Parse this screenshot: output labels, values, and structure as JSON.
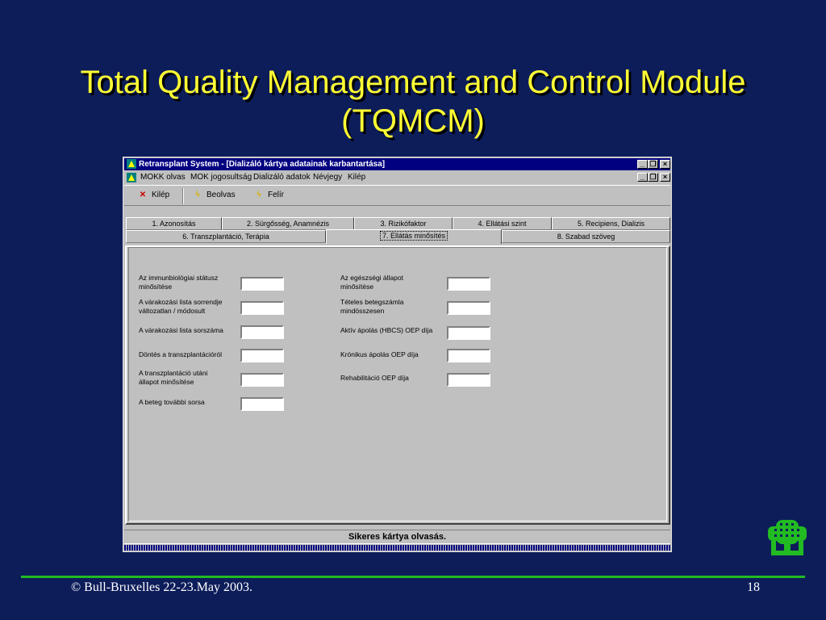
{
  "slide": {
    "title_line1": "Total Quality Management and Control Module",
    "title_line2": "(TQMCM)",
    "footer_left": "© Bull-Bruxelles 22-23.May 2003.",
    "footer_page": "18"
  },
  "window": {
    "title": "Retransplant System - [Dializáló kártya adatainak karbantartása]",
    "controls": {
      "minimize": "_",
      "restore": "❐",
      "close": "×"
    }
  },
  "menu": {
    "items": [
      "MOKK olvas",
      "MOK jogosultság",
      "Dializáló adatok",
      "Névjegy",
      "Kilép"
    ]
  },
  "toolbar": {
    "exit_label": "Kilép",
    "read_label": "Beolvas",
    "write_label": "Felír"
  },
  "tabs": {
    "row1": [
      "1. Azonosítás",
      "2. Sürgősség, Anamnézis",
      "3. Rizikófaktor",
      "4. Ellátási szint",
      "5. Recipiens, Dializis"
    ],
    "row2": [
      "6. Transzplantáció, Terápia",
      "7. Ellátás minősítés",
      "8. Szabad szöveg"
    ],
    "active": "7. Ellátás minősítés"
  },
  "form": {
    "left": [
      {
        "line1": "Az immunbiológiai státusz",
        "line2": "minősítése",
        "value": ""
      },
      {
        "line1": "A várakozási lista sorrendje",
        "line2": "változatlan / módosult",
        "value": ""
      },
      {
        "line1": "A várakozási lista sorszáma",
        "line2": "",
        "value": ""
      },
      {
        "line1": "Döntés a transzplantációról",
        "line2": "",
        "value": ""
      },
      {
        "line1": "A transzplantáció utáni",
        "line2": "állapot minősítése",
        "value": ""
      },
      {
        "line1": "A beteg további sorsa",
        "line2": "",
        "value": ""
      }
    ],
    "right": [
      {
        "line1": "Az egészségi állapot",
        "line2": "minősítése",
        "value": ""
      },
      {
        "line1": "Tételes betegszámla",
        "line2": "mindösszesen",
        "value": ""
      },
      {
        "line1": "Aktív ápolás (HBCS) OEP díja",
        "line2": "",
        "value": ""
      },
      {
        "line1": "Krónikus ápolás OEP díja",
        "line2": "",
        "value": ""
      },
      {
        "line1": "Rehabilitáció OEP díja",
        "line2": "",
        "value": ""
      }
    ]
  },
  "status": {
    "message": "Sikeres kártya olvasás."
  },
  "colors": {
    "slide_background": "#0d1d5a",
    "title_text": "#ffff33",
    "window_titlebar": "#000080",
    "divider_line": "#22bb22",
    "logo_green": "#22bb22"
  }
}
